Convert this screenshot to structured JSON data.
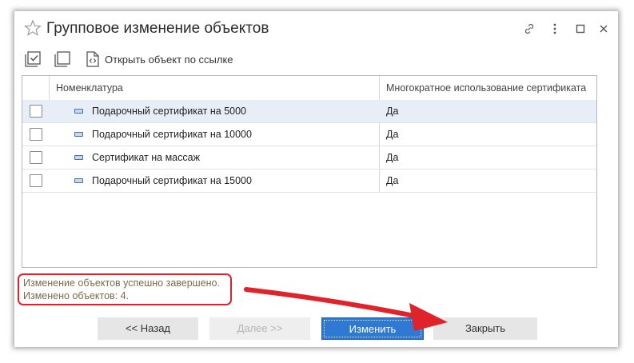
{
  "window": {
    "title": "Групповое изменение объектов"
  },
  "toolbar": {
    "open_by_link_label": "Открыть объект по ссылке"
  },
  "table": {
    "columns": [
      "Номенклатура",
      "Многократное использование сертификата"
    ],
    "rows": [
      {
        "name": "Подарочный сертификат на 5000",
        "reuse": "Да",
        "checked": false,
        "selected": true
      },
      {
        "name": "Подарочный сертификат на 10000",
        "reuse": "Да",
        "checked": false,
        "selected": false
      },
      {
        "name": "Сертификат на массаж",
        "reuse": "Да",
        "checked": false,
        "selected": false
      },
      {
        "name": "Подарочный сертификат на 15000",
        "reuse": "Да",
        "checked": false,
        "selected": false
      }
    ]
  },
  "status": {
    "line1": "Изменение объектов успешно завершено.",
    "line2": "Изменено объектов: 4."
  },
  "buttons": {
    "back": "<<   Назад",
    "next": "Далее   >>",
    "change": "Изменить",
    "close": "Закрыть"
  },
  "colors": {
    "accent": "#2f78d4",
    "annotation": "#e0232b",
    "status_text": "#7c6a4b",
    "selected_row": "#e8eef7"
  },
  "icons": [
    "star-icon",
    "link-icon",
    "more-icon",
    "maximize-icon",
    "close-icon",
    "check-all-icon",
    "uncheck-all-icon",
    "open-link-icon",
    "catalog-item-icon"
  ]
}
